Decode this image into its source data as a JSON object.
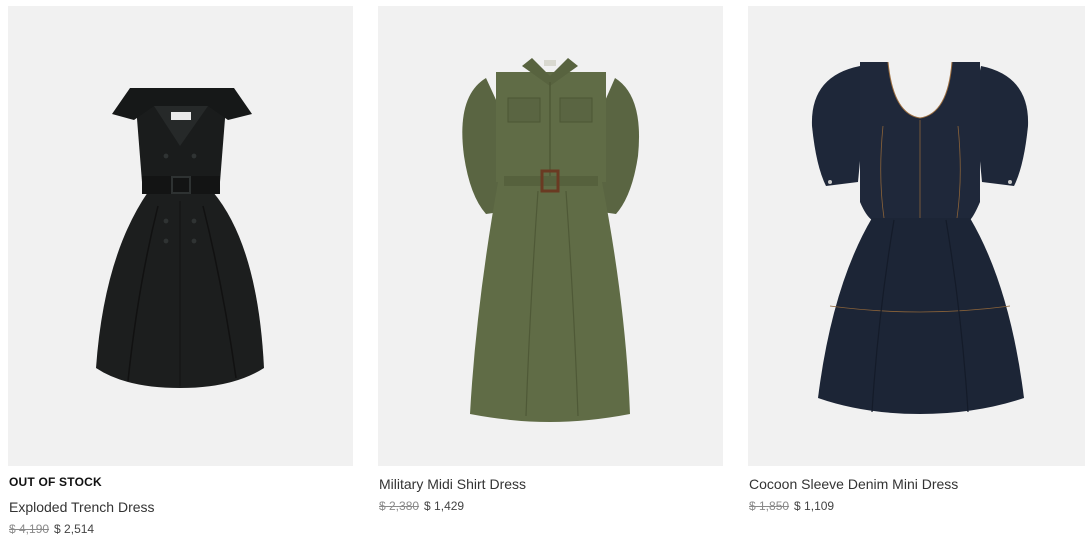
{
  "products": [
    {
      "badge": "OUT OF STOCK",
      "name": "Exploded Trench Dress",
      "original_price": "$ 4,190",
      "sale_price": "$ 2,514",
      "image": "black-trench-dress",
      "color": "#1a1c1c"
    },
    {
      "name": "Military Midi Shirt Dress",
      "original_price": "$ 2,380",
      "sale_price": "$ 1,429",
      "image": "green-shirt-dress",
      "color": "#5f6b45"
    },
    {
      "name": "Cocoon Sleeve Denim Mini Dress",
      "original_price": "$ 1,850",
      "sale_price": "$ 1,109",
      "image": "denim-mini-dress",
      "color": "#1d2638"
    }
  ]
}
